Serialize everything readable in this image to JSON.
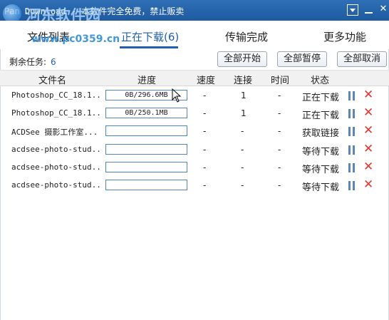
{
  "window": {
    "title": "Pan Download - 本软件完全免费，禁止贩卖",
    "watermark_text": "河东软件园",
    "watermark_url": "www.pc0359.cn"
  },
  "tabs": [
    {
      "label": "文件列表",
      "active": false
    },
    {
      "label": "正在下载(6)",
      "active": true
    },
    {
      "label": "传输完成",
      "active": false
    },
    {
      "label": "更多功能",
      "active": false
    }
  ],
  "toolbar": {
    "remaining_label": "剩余任务:",
    "remaining_count": "6",
    "start_all": "全部开始",
    "pause_all": "全部暂停",
    "cancel_all": "全部取消"
  },
  "columns": {
    "name": "文件名",
    "progress": "进度",
    "speed": "速度",
    "connections": "连接",
    "time": "时间",
    "status": "状态"
  },
  "rows": [
    {
      "name": "Photoshop_CC_18.1...",
      "progress_text": "0B/296.6MB",
      "progress": 0,
      "speed": "-",
      "connections": "1",
      "time": "-",
      "status": "正在下载"
    },
    {
      "name": "Photoshop_CC_18.1...",
      "progress_text": "0B/250.1MB",
      "progress": 0,
      "speed": "-",
      "connections": "1",
      "time": "-",
      "status": "正在下载"
    },
    {
      "name": "ACDSee 摄影工作室...",
      "progress_text": "",
      "progress": 0,
      "speed": "-",
      "connections": "-",
      "time": "-",
      "status": "获取链接"
    },
    {
      "name": "acdsee-photo-stud...",
      "progress_text": "",
      "progress": 0,
      "speed": "-",
      "connections": "-",
      "time": "-",
      "status": "等待下载"
    },
    {
      "name": "acdsee-photo-stud...",
      "progress_text": "",
      "progress": 0,
      "speed": "-",
      "connections": "-",
      "time": "-",
      "status": "等待下载"
    },
    {
      "name": "acdsee-photo-stud...",
      "progress_text": "",
      "progress": 0,
      "speed": "-",
      "connections": "-",
      "time": "-",
      "status": "等待下载"
    }
  ],
  "colors": {
    "titlebar": "#2f6fb5",
    "accent": "#1f5fb0",
    "progress_border": "#4f87c6",
    "delete": "#e2362f",
    "pause": "#5a86b8"
  },
  "icons": [
    "menu-dropdown-icon",
    "minimize-icon",
    "close-icon",
    "pause-icon",
    "delete-icon",
    "mouse-cursor-icon"
  ]
}
